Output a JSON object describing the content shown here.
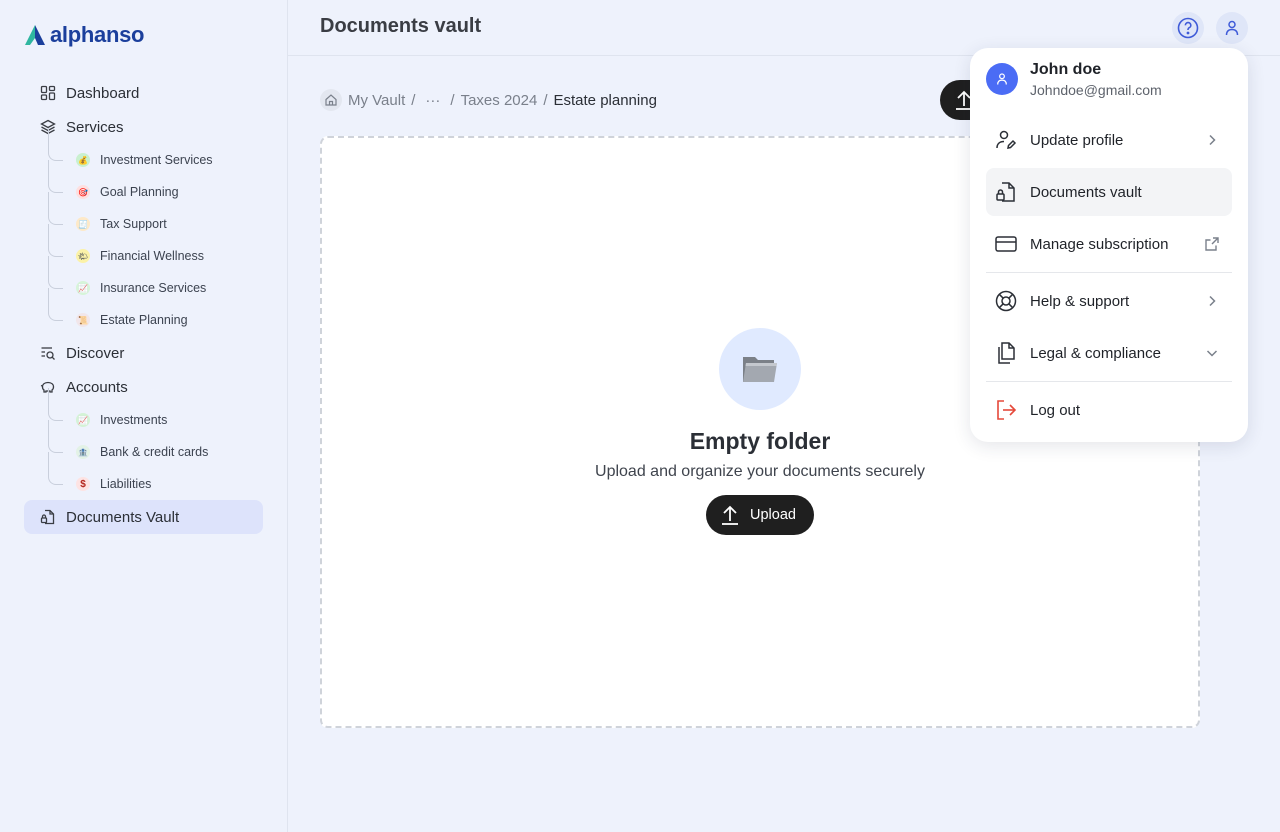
{
  "app": {
    "name": "alphanso",
    "brand_color": "#1b3f9c",
    "accent": "#4b6cf5"
  },
  "sidebar": {
    "dashboard": "Dashboard",
    "services": {
      "label": "Services",
      "items": [
        {
          "label": "Investment Services",
          "icon": "money-bag-icon"
        },
        {
          "label": "Goal Planning",
          "icon": "target-icon"
        },
        {
          "label": "Tax Support",
          "icon": "receipt-icon"
        },
        {
          "label": "Financial Wellness",
          "icon": "wellness-icon"
        },
        {
          "label": "Insurance Services",
          "icon": "chart-icon"
        },
        {
          "label": "Estate Planning",
          "icon": "scroll-icon"
        }
      ]
    },
    "discover": "Discover",
    "accounts": {
      "label": "Accounts",
      "items": [
        {
          "label": "Investments",
          "icon": "trend-icon"
        },
        {
          "label": "Bank & credit cards",
          "icon": "bank-icon"
        },
        {
          "label": "Liabilities",
          "icon": "dollar-icon"
        }
      ]
    },
    "documents_vault": "Documents Vault"
  },
  "header": {
    "title": "Documents vault"
  },
  "breadcrumb": {
    "items": [
      "My Vault",
      "···",
      "Taxes 2024"
    ],
    "separator": "/",
    "current": "Estate planning"
  },
  "empty_state": {
    "title": "Empty folder",
    "subtitle": "Upload and organize your documents securely",
    "button": "Upload"
  },
  "menu": {
    "user_name": "John doe",
    "user_email": "Johndoe@gmail.com",
    "items": [
      "Update profile",
      "Documents vault",
      "Manage subscription",
      "Help & support",
      "Legal & compliance",
      "Log out"
    ],
    "logout_color": "#e5483a"
  }
}
